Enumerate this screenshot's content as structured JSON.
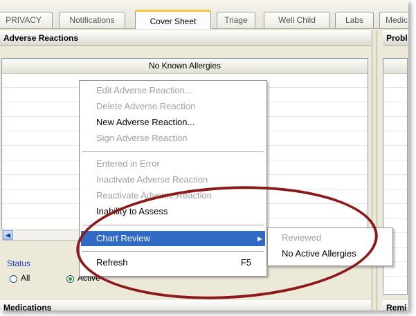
{
  "tabs": [
    {
      "label": "PRIVACY",
      "active": false
    },
    {
      "label": "Notifications",
      "active": false
    },
    {
      "label": "Cover Sheet",
      "active": true
    },
    {
      "label": "Triage",
      "active": false
    },
    {
      "label": "Well Child",
      "active": false
    },
    {
      "label": "Labs",
      "active": false
    },
    {
      "label": "Medic",
      "active": false
    }
  ],
  "adverse_reactions": {
    "title": "Adverse Reactions",
    "column_header": "No Known Allergies",
    "status_label": "Status",
    "radio_all": "All",
    "radio_active": "Active",
    "selected": "Active"
  },
  "problems_panel": {
    "title": "Probl"
  },
  "medications_panel": {
    "title": "Medications"
  },
  "reminders_panel": {
    "title": "Remi"
  },
  "context_menu": {
    "items": [
      {
        "label": "Edit Adverse Reaction...",
        "enabled": false
      },
      {
        "label": "Delete Adverse Reaction",
        "enabled": false
      },
      {
        "label": "New Adverse Reaction...",
        "enabled": true
      },
      {
        "label": "Sign Adverse Reaction",
        "enabled": false
      },
      {
        "label": "Entered in Error",
        "enabled": false
      },
      {
        "label": "Inactivate Adverse Reaction",
        "enabled": false
      },
      {
        "label": "Reactivate Adverse Reaction",
        "enabled": false
      },
      {
        "label": "Inability to Assess",
        "enabled": true
      },
      {
        "label": "Chart Review",
        "enabled": true,
        "highlighted": true,
        "submenu": true
      },
      {
        "label": "Refresh",
        "enabled": true,
        "shortcut": "F5"
      }
    ]
  },
  "submenu": {
    "items": [
      {
        "label": "Reviewed",
        "enabled": false
      },
      {
        "label": "No Active Allergies",
        "enabled": true
      }
    ]
  },
  "colors": {
    "highlight": "#316ac5",
    "annotation_ellipse": "#8b1a1a",
    "active_tab_accent": "#ffc83c"
  }
}
